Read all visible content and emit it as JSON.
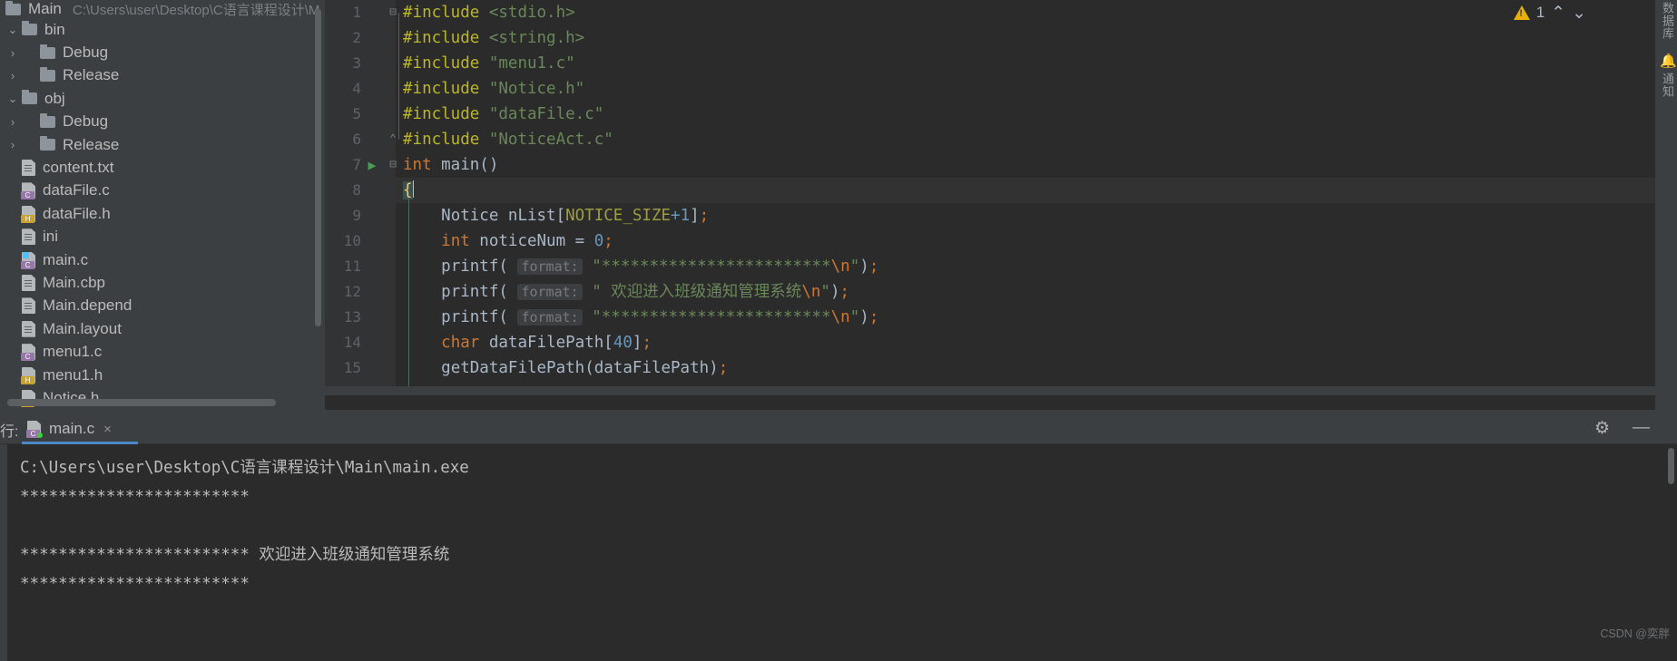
{
  "project": {
    "name": "Main",
    "path": "C:\\Users\\user\\Desktop\\C语言课程设计\\M",
    "tree": [
      {
        "label": "bin",
        "twisty": "⌄",
        "kind": "folder",
        "indent": 0
      },
      {
        "label": "Debug",
        "twisty": "›",
        "kind": "folder",
        "indent": 1
      },
      {
        "label": "Release",
        "twisty": "›",
        "kind": "folder",
        "indent": 1
      },
      {
        "label": "obj",
        "twisty": "⌄",
        "kind": "folder",
        "indent": 0
      },
      {
        "label": "Debug",
        "twisty": "›",
        "kind": "folder",
        "indent": 1
      },
      {
        "label": "Release",
        "twisty": "›",
        "kind": "folder",
        "indent": 1
      },
      {
        "label": "content.txt",
        "twisty": "",
        "kind": "text",
        "indent": 0
      },
      {
        "label": "dataFile.c",
        "twisty": "",
        "kind": "c",
        "indent": 0
      },
      {
        "label": "dataFile.h",
        "twisty": "",
        "kind": "h",
        "indent": 0
      },
      {
        "label": "ini",
        "twisty": "",
        "kind": "text",
        "indent": 0
      },
      {
        "label": "main.c",
        "twisty": "",
        "kind": "c-open",
        "indent": 0
      },
      {
        "label": "Main.cbp",
        "twisty": "",
        "kind": "text",
        "indent": 0
      },
      {
        "label": "Main.depend",
        "twisty": "",
        "kind": "text",
        "indent": 0
      },
      {
        "label": "Main.layout",
        "twisty": "",
        "kind": "text",
        "indent": 0
      },
      {
        "label": "menu1.c",
        "twisty": "",
        "kind": "c",
        "indent": 0
      },
      {
        "label": "menu1.h",
        "twisty": "",
        "kind": "h",
        "indent": 0
      },
      {
        "label": "Notice.h",
        "twisty": "",
        "kind": "h",
        "indent": 0
      }
    ]
  },
  "editor": {
    "warning_count": "1",
    "up_chevron": "⌃",
    "down_chevron": "⌄",
    "lines": [
      {
        "n": "1",
        "fold": "⊟",
        "run": "",
        "text": "#include <stdio.h>"
      },
      {
        "n": "2",
        "fold": "",
        "run": "",
        "text": "#include <string.h>"
      },
      {
        "n": "3",
        "fold": "",
        "run": "",
        "text": "#include \"menu1.c\""
      },
      {
        "n": "4",
        "fold": "",
        "run": "",
        "text": "#include \"Notice.h\""
      },
      {
        "n": "5",
        "fold": "",
        "run": "",
        "text": "#include \"dataFile.c\""
      },
      {
        "n": "6",
        "fold": "⌃",
        "run": "",
        "text": "#include \"NoticeAct.c\""
      },
      {
        "n": "7",
        "fold": "⊟",
        "run": "▶",
        "text": "int main()"
      },
      {
        "n": "8",
        "fold": "",
        "run": "",
        "text": "{"
      },
      {
        "n": "9",
        "fold": "",
        "run": "",
        "text": "    Notice nList[NOTICE_SIZE+1];"
      },
      {
        "n": "10",
        "fold": "",
        "run": "",
        "text": "    int noticeNum = 0;"
      },
      {
        "n": "11",
        "fold": "",
        "run": "",
        "text": "    printf( format: \"************************\\n\");"
      },
      {
        "n": "12",
        "fold": "",
        "run": "",
        "text": "    printf( format: \" 欢迎进入班级通知管理系统\\n\");"
      },
      {
        "n": "13",
        "fold": "",
        "run": "",
        "text": "    printf( format: \"************************\\n\");"
      },
      {
        "n": "14",
        "fold": "",
        "run": "",
        "text": "    char dataFilePath[40];"
      },
      {
        "n": "15",
        "fold": "",
        "run": "",
        "text": "    getDataFilePath(dataFilePath);"
      }
    ],
    "hint_label": "format:"
  },
  "right_strip": {
    "top_label": "数据库",
    "bell_icon": "🔔",
    "bottom_label": "通知"
  },
  "run_panel": {
    "title_prefix": "行:",
    "tab_label": "main.c",
    "close_icon": "×",
    "gear_icon": "⚙",
    "minimize_icon": "—",
    "console_lines": [
      "C:\\Users\\user\\Desktop\\C语言课程设计\\Main\\main.exe",
      "************************",
      "",
      "************************ 欢迎进入班级通知管理系统",
      "************************"
    ]
  },
  "watermark": "CSDN @奕胖",
  "colors": {
    "panel_bg": "#3c3f41",
    "editor_bg": "#2b2b2b",
    "accent_blue": "#4a88c7",
    "keyword": "#cc7832",
    "string": "#6a8759",
    "preproc": "#bbb529",
    "number": "#6897bb",
    "text": "#a9b7c6",
    "warning": "#e8b007"
  }
}
